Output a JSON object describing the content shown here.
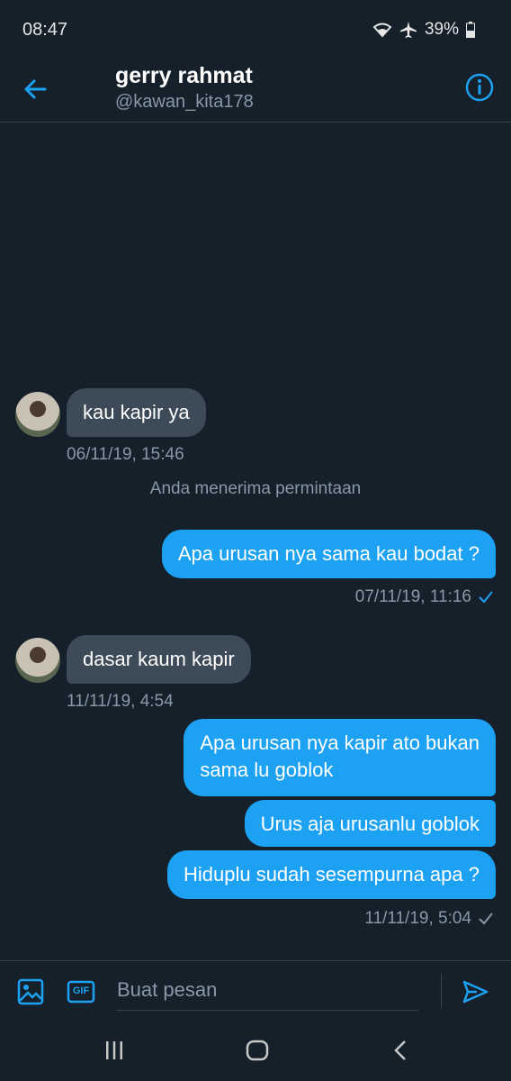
{
  "status_bar": {
    "time": "08:47",
    "battery": "39%"
  },
  "header": {
    "name": "gerry rahmat",
    "handle": "@kawan_kita178"
  },
  "messages": [
    {
      "text": "kau kapir ya",
      "timestamp": "06/11/19, 15:46"
    },
    {
      "text": "Anda menerima permintaan"
    },
    {
      "text": "Apa urusan nya sama kau bodat ?",
      "timestamp": "07/11/19, 11:16"
    },
    {
      "text": "dasar kaum kapir",
      "timestamp": "11/11/19, 4:54"
    },
    {
      "text_line1": "Apa urusan nya kapir ato bukan",
      "text_line2": "sama lu goblok"
    },
    {
      "text": "Urus aja urusanlu goblok"
    },
    {
      "text": "Hiduplu sudah sesempurna apa ?",
      "timestamp": "11/11/19, 5:04"
    }
  ],
  "composer": {
    "placeholder": "Buat pesan",
    "gif_label": "GIF"
  },
  "colors": {
    "background": "#15202b",
    "accent": "#1da1f2",
    "incoming_bubble": "#3d4a57",
    "muted_text": "#8899a6"
  },
  "icons": [
    "back-arrow-icon",
    "info-icon",
    "image-icon",
    "gif-icon",
    "send-icon",
    "recent-apps-icon",
    "home-icon",
    "back-nav-icon"
  ]
}
